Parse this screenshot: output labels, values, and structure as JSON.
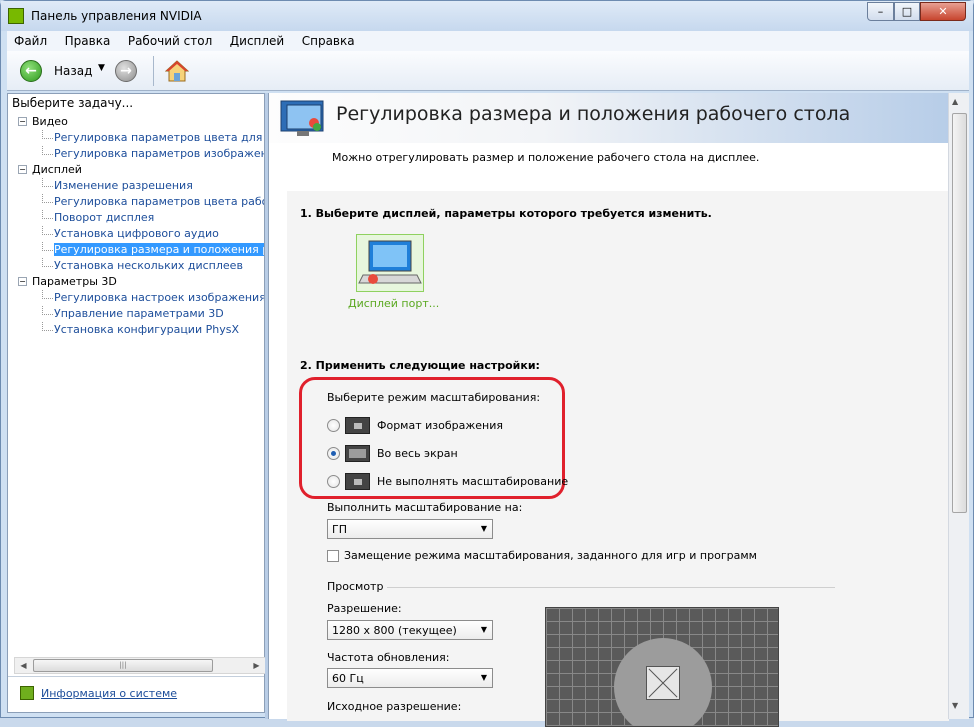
{
  "window": {
    "title": "Панель управления NVIDIA",
    "min": "–",
    "max": "□",
    "close": "✕"
  },
  "menu": [
    {
      "label": "Файл"
    },
    {
      "label": "Правка"
    },
    {
      "label": "Рабочий стол"
    },
    {
      "label": "Дисплей"
    },
    {
      "label": "Справка"
    }
  ],
  "toolbar": {
    "back_label": "Назад",
    "back_icon": "back-arrow-icon",
    "forward_icon": "forward-arrow-icon",
    "home_icon": "home-icon"
  },
  "left": {
    "heading": "Выберите задачу...",
    "groups": [
      {
        "label": "Видео",
        "items": [
          "Регулировка параметров цвета для вид",
          "Регулировка параметров изображения д"
        ]
      },
      {
        "label": "Дисплей",
        "items": [
          "Изменение разрешения",
          "Регулировка параметров цвета рабочег",
          "Поворот дисплея",
          "Установка цифрового аудио",
          "Регулировка размера и положения рабо",
          "Установка нескольких дисплеев"
        ]
      },
      {
        "label": "Параметры 3D",
        "items": [
          "Регулировка настроек изображения с пр",
          "Управление параметрами 3D",
          "Установка конфигурации PhysX"
        ]
      }
    ],
    "selected_item": "Регулировка размера и положения рабо",
    "footer_link": "Информация о системе"
  },
  "main": {
    "title": "Регулировка размера и положения рабочего стола",
    "description": "Можно отрегулировать размер и положение рабочего стола на дисплее.",
    "step1": "1. Выберите дисплей, параметры которого требуется изменить.",
    "display_label": "Дисплей порт...",
    "step2": "2. Применить следующие настройки:",
    "scaling_mode_label": "Выберите режим масштабирования:",
    "options": [
      {
        "label": "Формат изображения",
        "selected": false
      },
      {
        "label": "Во весь экран",
        "selected": true
      },
      {
        "label": "Не выполнять масштабирование",
        "selected": false
      }
    ],
    "scale_on_label": "Выполнить масштабирование на:",
    "scale_on_value": "ГП",
    "override_label": "Замещение режима масштабирования, заданного для игр и программ",
    "preview_label": "Просмотр",
    "resolution_label": "Разрешение:",
    "resolution_value": "1280 x 800 (текущее)",
    "refresh_label": "Частота обновления:",
    "refresh_value": "60 Гц",
    "source_label": "Исходное разрешение:"
  }
}
